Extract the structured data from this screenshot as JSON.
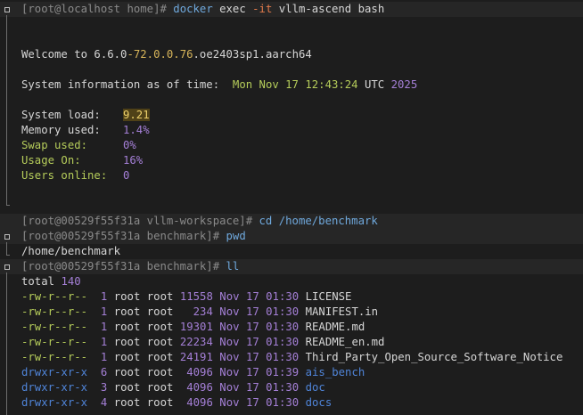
{
  "prompt1": {
    "user_host": "[root@localhost home]",
    "sym": "#",
    "cmd": "docker",
    "args1": " exec ",
    "flag": "-it",
    "args2": " vllm-ascend bash"
  },
  "welcome": {
    "pre": "Welcome to 6.6.0",
    "ver": "-72.0.0.76",
    "post": ".oe2403sp1.aarch64"
  },
  "sysinfo": {
    "label": "System information as of time:",
    "date": "Mon Nov 17 12:43:24",
    "tz": "UTC",
    "year": "2025"
  },
  "stats": [
    {
      "label": "System load:",
      "value": "9.21"
    },
    {
      "label": "Memory used:",
      "value": "1.4%"
    },
    {
      "label": "Swap used:",
      "value": "0%"
    },
    {
      "label": "Usage On:",
      "value": "16%"
    },
    {
      "label": "Users online:",
      "value": "0"
    }
  ],
  "prompt2": {
    "user_host": "[root@00529f55f31a vllm-workspace]",
    "sym": "#",
    "cmd": "cd",
    "args": " /home/benchmark"
  },
  "prompt3": {
    "user_host": "[root@00529f55f31a benchmark]",
    "sym": "#",
    "cmd": "pwd"
  },
  "pwd_output": "/home/benchmark",
  "prompt4": {
    "user_host": "[root@00529f55f31a benchmark]",
    "sym": "#",
    "cmd": "ll"
  },
  "total": {
    "label": "total",
    "value": "140"
  },
  "files": [
    {
      "perm": "-rw-r--r--",
      "links": "1",
      "owner": "root",
      "group": "root",
      "size": "11558",
      "month": "Nov",
      "day": "17",
      "time": "01:30",
      "name": "LICENSE",
      "dir": false
    },
    {
      "perm": "-rw-r--r--",
      "links": "1",
      "owner": "root",
      "group": "root",
      "size": "234",
      "month": "Nov",
      "day": "17",
      "time": "01:30",
      "name": "MANIFEST.in",
      "dir": false
    },
    {
      "perm": "-rw-r--r--",
      "links": "1",
      "owner": "root",
      "group": "root",
      "size": "19301",
      "month": "Nov",
      "day": "17",
      "time": "01:30",
      "name": "README.md",
      "dir": false
    },
    {
      "perm": "-rw-r--r--",
      "links": "1",
      "owner": "root",
      "group": "root",
      "size": "22234",
      "month": "Nov",
      "day": "17",
      "time": "01:30",
      "name": "README_en.md",
      "dir": false
    },
    {
      "perm": "-rw-r--r--",
      "links": "1",
      "owner": "root",
      "group": "root",
      "size": "24191",
      "month": "Nov",
      "day": "17",
      "time": "01:30",
      "name": "Third_Party_Open_Source_Software_Notice",
      "dir": false
    },
    {
      "perm": "drwxr-xr-x",
      "links": "6",
      "owner": "root",
      "group": "root",
      "size": "4096",
      "month": "Nov",
      "day": "17",
      "time": "01:39",
      "name": "ais_bench",
      "dir": true
    },
    {
      "perm": "drwxr-xr-x",
      "links": "3",
      "owner": "root",
      "group": "root",
      "size": "4096",
      "month": "Nov",
      "day": "17",
      "time": "01:30",
      "name": "doc",
      "dir": true
    },
    {
      "perm": "drwxr-xr-x",
      "links": "4",
      "owner": "root",
      "group": "root",
      "size": "4096",
      "month": "Nov",
      "day": "17",
      "time": "01:30",
      "name": "docs",
      "dir": true
    }
  ],
  "colors": {
    "background": "#1d1d1d",
    "text": "#d6d6d6",
    "command": "#6fa8dc",
    "green": "#b5cc5a",
    "purple": "#a47fd6",
    "directory": "#4f84d8"
  }
}
